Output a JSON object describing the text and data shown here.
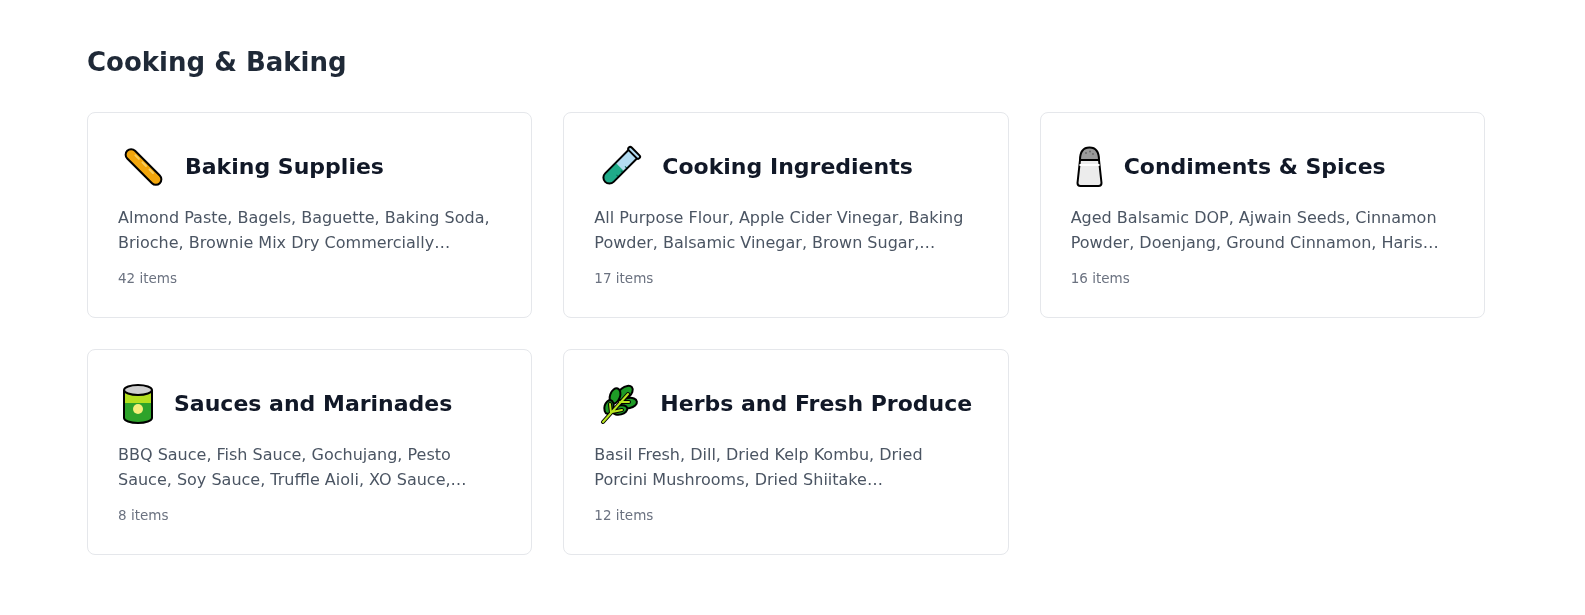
{
  "section": {
    "title": "Cooking & Baking"
  },
  "categories": [
    {
      "name": "Baking Supplies",
      "items_preview": "Almond Paste, Bagels, Baguette, Baking Soda, Brioche, Brownie Mix Dry Commercially…",
      "count": "42 items"
    },
    {
      "name": "Cooking Ingredients",
      "items_preview": "All Purpose Flour, Apple Cider Vinegar, Baking Powder, Balsamic Vinegar, Brown Sugar,…",
      "count": "17 items"
    },
    {
      "name": "Condiments & Spices",
      "items_preview": "Aged Balsamic DOP, Ajwain Seeds, Cinnamon Powder, Doenjang, Ground Cinnamon, Haris…",
      "count": "16 items"
    },
    {
      "name": "Sauces and Marinades",
      "items_preview": "BBQ Sauce, Fish Sauce, Gochujang, Pesto Sauce, Soy Sauce, Truffle Aioli, XO Sauce,…",
      "count": "8 items"
    },
    {
      "name": "Herbs and Fresh Produce",
      "items_preview": "Basil Fresh, Dill, Dried Kelp Kombu, Dried Porcini Mushrooms, Dried Shiitake…",
      "count": "12 items"
    }
  ]
}
